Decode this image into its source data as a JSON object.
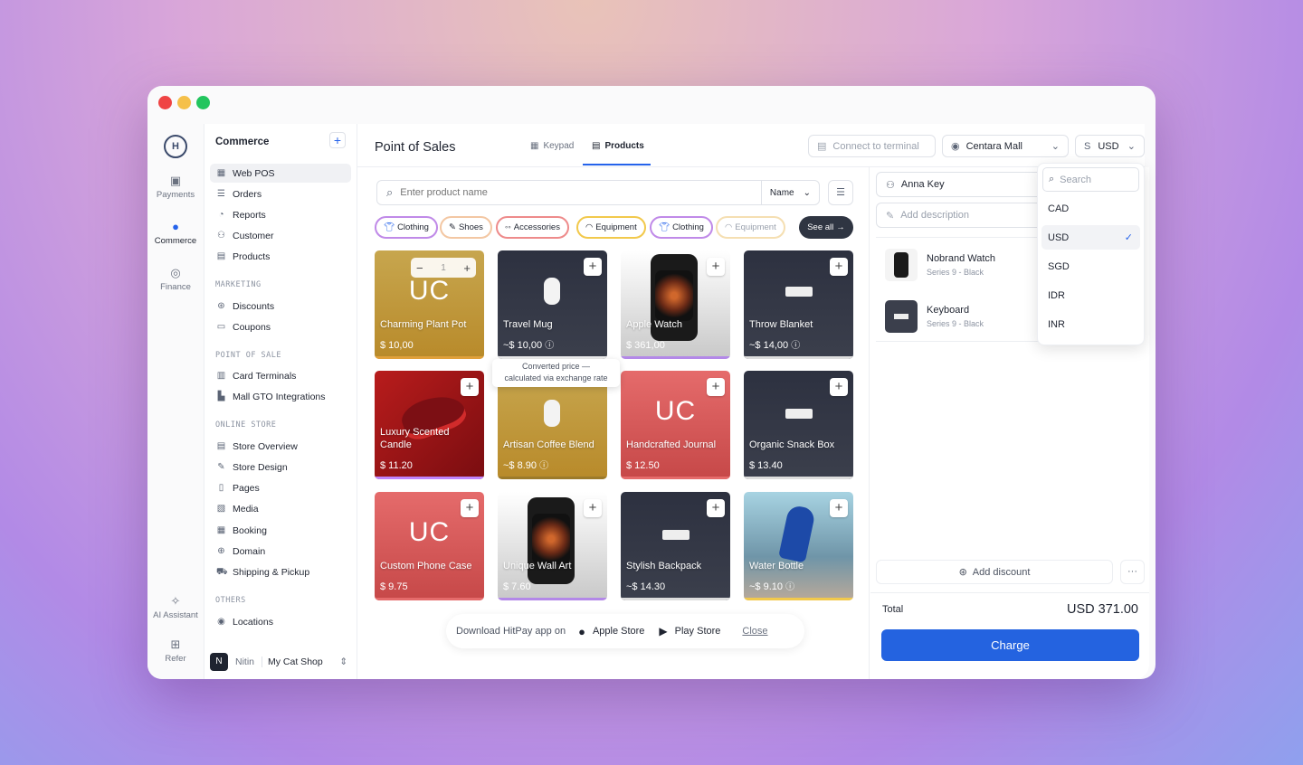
{
  "colors": {
    "accent": "#2563eb",
    "dark": "#1f2430"
  },
  "rail": {
    "logo": "H",
    "items": [
      {
        "label": "Payments",
        "icon": "payments-icon"
      },
      {
        "label": "Commerce",
        "icon": "commerce-icon"
      },
      {
        "label": "Finance",
        "icon": "finance-icon"
      },
      {
        "label": "AI Assistant",
        "icon": "ai-icon"
      },
      {
        "label": "Refer",
        "icon": "gift-icon"
      }
    ]
  },
  "sidebar": {
    "title": "Commerce",
    "nav": [
      "Web POS",
      "Orders",
      "Reports",
      "Customer",
      "Products"
    ],
    "marketing_label": "MARKETING",
    "marketing": [
      "Discounts",
      "Coupons"
    ],
    "pos_label": "POINT OF SALE",
    "pos": [
      "Card Terminals",
      "Mall GTO Integrations"
    ],
    "online_label": "ONLINE STORE",
    "online": [
      "Store Overview",
      "Store Design",
      "Pages",
      "Media",
      "Booking",
      "Domain",
      "Shipping & Pickup"
    ],
    "others_label": "OTHERS",
    "others": [
      "Locations"
    ],
    "user": {
      "initial": "N",
      "name": "Nitin",
      "shop": "My Cat Shop"
    }
  },
  "header": {
    "title": "Point of Sales",
    "tabs": [
      "Keypad",
      "Products"
    ],
    "terminal": "Connect to terminal",
    "location": "Centara Mall",
    "currency_symbol": "S",
    "currency": "USD"
  },
  "search": {
    "placeholder": "Enter product name",
    "sort": "Name"
  },
  "chips": [
    "Clothing",
    "Shoes",
    "Accessories",
    "Equipment",
    "Clothing",
    "Equipment"
  ],
  "see_all": "See all",
  "products": [
    {
      "name": "Charming Plant Pot",
      "price": "$ 10,00",
      "qty": "1"
    },
    {
      "name": "Travel Mug",
      "price": "~$ 10,00"
    },
    {
      "name": "Apple Watch",
      "price": "$ 361,00"
    },
    {
      "name": "Throw Blanket",
      "price": "~$ 14,00"
    },
    {
      "name": "Luxury Scented Candle",
      "price": "$ 11.20"
    },
    {
      "name": "Artisan Coffee Blend",
      "price": "~$ 8.90"
    },
    {
      "name": "Handcrafted Journal",
      "price": "$ 12.50"
    },
    {
      "name": "Organic Snack Box",
      "price": "$ 13.40"
    },
    {
      "name": "Custom Phone Case",
      "price": "$ 9.75"
    },
    {
      "name": "Unique Wall Art",
      "price": "$ 7.60"
    },
    {
      "name": "Stylish Backpack",
      "price": "~$ 14.30"
    },
    {
      "name": "Water Bottle",
      "price": "~$ 9.10"
    }
  ],
  "placeholder_initials": "UC",
  "tooltip": {
    "line1": "Converted price —",
    "line2": "calculated via exchange rate"
  },
  "banner": {
    "text": "Download HitPay app on",
    "apple": "Apple Store",
    "play": "Play Store",
    "close": "Close"
  },
  "cart": {
    "customer": "Anna Key",
    "description_placeholder": "Add description",
    "items": [
      {
        "name": "Nobrand Watch",
        "variant": "Series 9 - Black"
      },
      {
        "name": "Keyboard",
        "variant": "Series 9 - Black"
      }
    ],
    "add_discount": "Add discount",
    "total_label": "Total",
    "total": "USD 371.00",
    "charge": "Charge"
  },
  "currency_menu": {
    "search_placeholder": "Search",
    "options": [
      "CAD",
      "USD",
      "SGD",
      "IDR",
      "INR"
    ],
    "selected": "USD"
  }
}
